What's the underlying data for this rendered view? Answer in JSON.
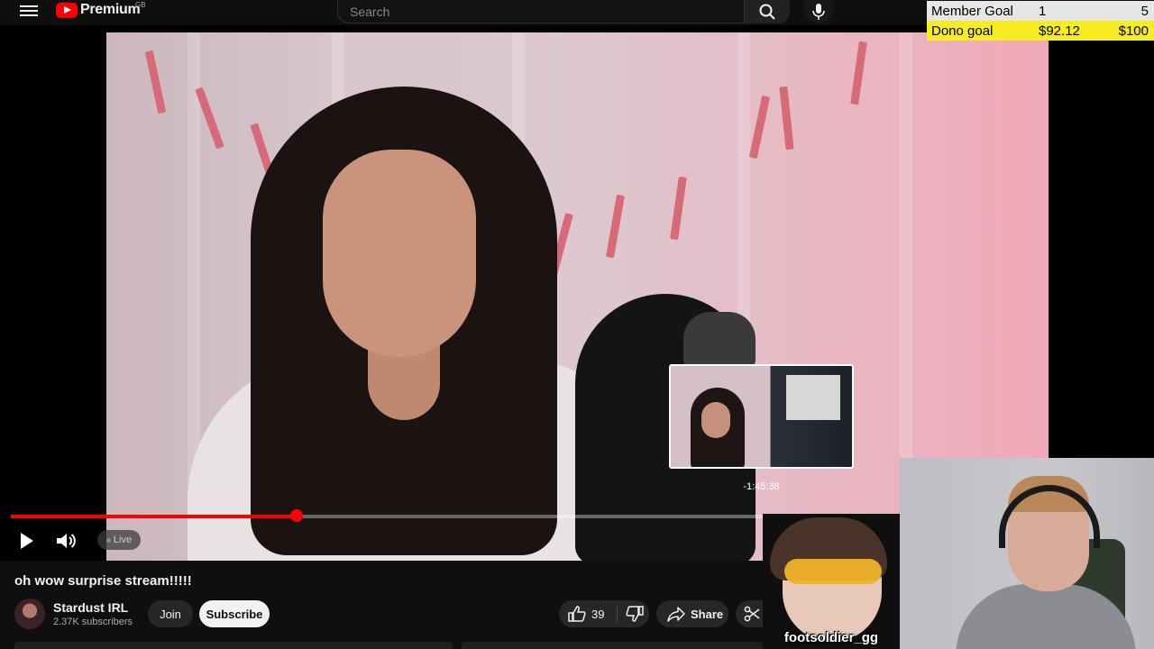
{
  "header": {
    "logo_text": "Premium",
    "region": "GB",
    "search_placeholder": "Search"
  },
  "goals": {
    "member": {
      "label": "Member Goal",
      "current": "1",
      "target": "5"
    },
    "dono": {
      "label": "Dono goal",
      "current": "$92.12",
      "target": "$100"
    }
  },
  "player": {
    "progress_fraction": 0.38,
    "preview_time": "-1:45:38",
    "live_label": "Live"
  },
  "video": {
    "title": "oh wow surprise stream!!!!!"
  },
  "channel": {
    "name": "Stardust IRL",
    "subscribers": "2.37K subscribers",
    "join_label": "Join",
    "subscribe_label": "Subscribe"
  },
  "actions": {
    "like_count": "39",
    "share_label": "Share"
  },
  "overlay": {
    "vtuber_name": "footsoldier_gg"
  },
  "colors": {
    "accent": "#ff0000",
    "dono_bar": "#f5ec22",
    "member_bar": "#e6e6e6"
  }
}
